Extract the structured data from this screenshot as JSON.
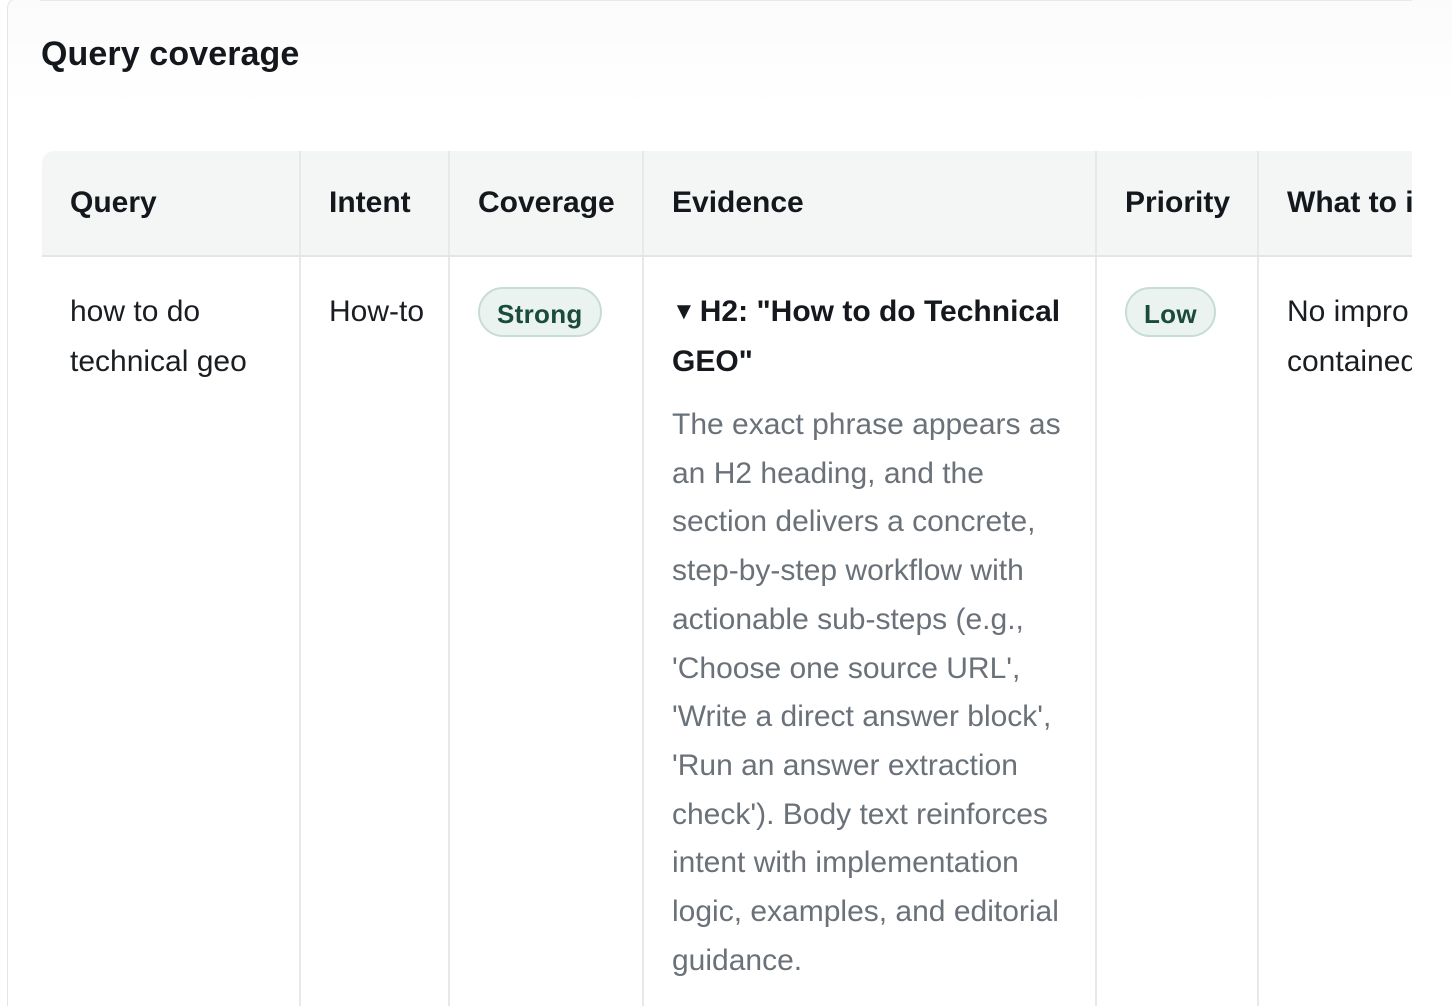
{
  "section": {
    "title": "Query coverage"
  },
  "table": {
    "headers": {
      "query": "Query",
      "intent": "Intent",
      "coverage": "Coverage",
      "evidence": "Evidence",
      "priority": "Priority",
      "what": "What to i"
    },
    "rows": [
      {
        "query": "how to do technical geo",
        "intent": "How-to",
        "coverage": "Strong",
        "evidence_summary": "H2: \"How to do Technical GEO\"",
        "evidence_body": "The exact phrase appears as an H2 heading, and the section delivers a concrete, step-by-step workflow with actionable sub-steps (e.g., 'Choose one source URL', 'Write a direct answer block', 'Run an answer extraction check'). Body text reinforces intent with implementation logic, examples, and editorial guidance.",
        "priority": "Low",
        "what": "No impro is well-st contained"
      }
    ]
  },
  "colors": {
    "pill_bg": "#eaf3ef",
    "pill_border": "#c7ddd3",
    "pill_text": "#1b4b3a",
    "header_bg": "#f4f6f6",
    "muted_text": "#6a7178"
  },
  "icons": {
    "evidence_toggle": "triangle-down-icon"
  }
}
